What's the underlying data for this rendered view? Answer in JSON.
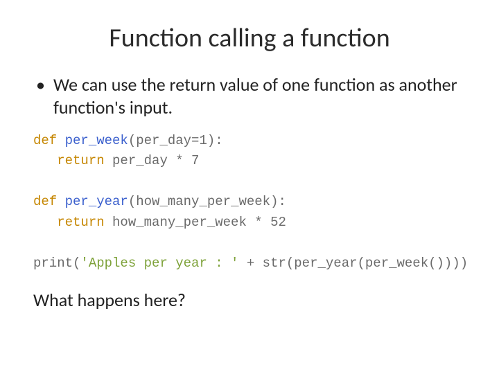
{
  "title": "Function calling a function",
  "bullet": "We can use the return value of one function as another function's input.",
  "code": {
    "l1_def": "def",
    "l1_fn": " per_week",
    "l1_rest": "(per_day=1):",
    "l2_ret": "   return",
    "l2_rest": " per_day * 7",
    "l3": "",
    "l4_def": "def",
    "l4_fn": " per_year",
    "l4_rest": "(how_many_per_week):",
    "l5_ret": "   return",
    "l5_rest": " how_many_per_week * 52",
    "l6": "",
    "l7_a": "print(",
    "l7_str": "'Apples per year : '",
    "l7_b": " + str(per_year(per_week())))"
  },
  "question": "What happens here?"
}
